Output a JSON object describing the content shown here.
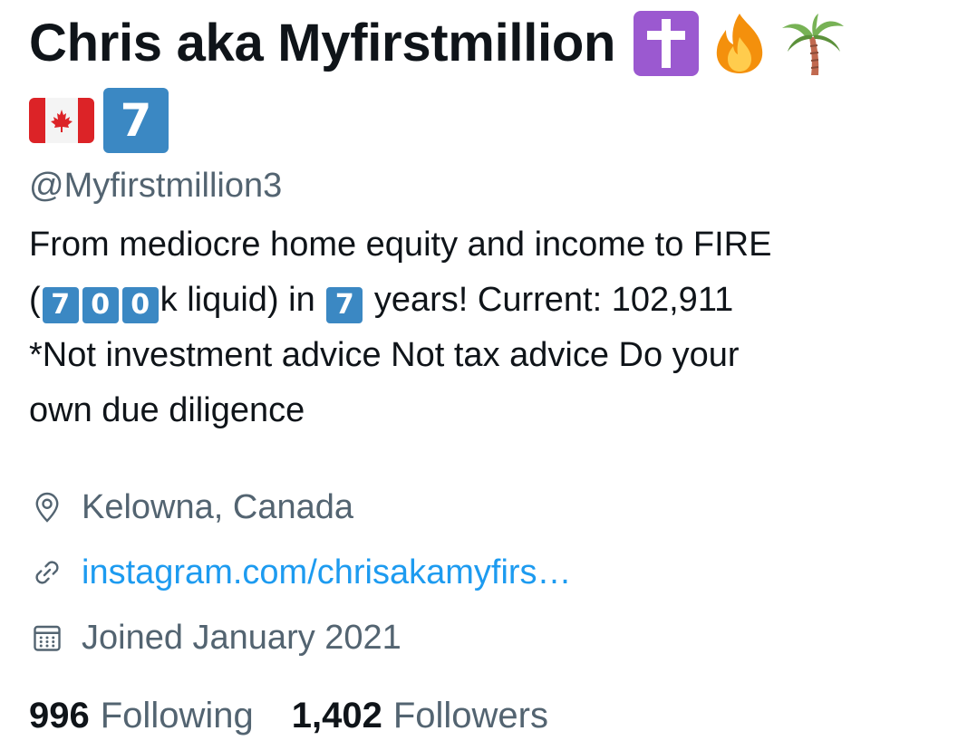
{
  "profile": {
    "display_name": "Chris aka Myfirstmillion",
    "name_emojis": [
      "latin-cross-emoji",
      "fire-emoji",
      "palm-tree-emoji",
      "canada-flag-emoji",
      "keycap-seven-emoji"
    ],
    "name_keycap": "7",
    "handle": "@Myfirstmillion3",
    "bio": {
      "line1": "From mediocre home equity and income to FIRE",
      "paren_open": "(",
      "keycaps_amount": [
        "7",
        "0",
        "0"
      ],
      "amount_suffix": "k liquid) in",
      "keycap_years": "7",
      "years_text": "years! Current: 102,911",
      "line3": "*Not investment advice Not tax advice Do your",
      "line4": "own due diligence"
    },
    "location": {
      "icon": "location-pin-icon",
      "text": "Kelowna, Canada"
    },
    "website": {
      "icon": "link-icon",
      "text": "instagram.com/chrisakamyfirs…"
    },
    "joined": {
      "icon": "calendar-icon",
      "text": "Joined January 2021"
    },
    "following": {
      "count": "996",
      "label": "Following"
    },
    "followers": {
      "count": "1,402",
      "label": "Followers"
    }
  },
  "colors": {
    "text_primary": "#0f1419",
    "text_secondary": "#536471",
    "link": "#1d9bf0",
    "keycap_blue": "#3b88c3",
    "cross_purple": "#9b59d0"
  }
}
